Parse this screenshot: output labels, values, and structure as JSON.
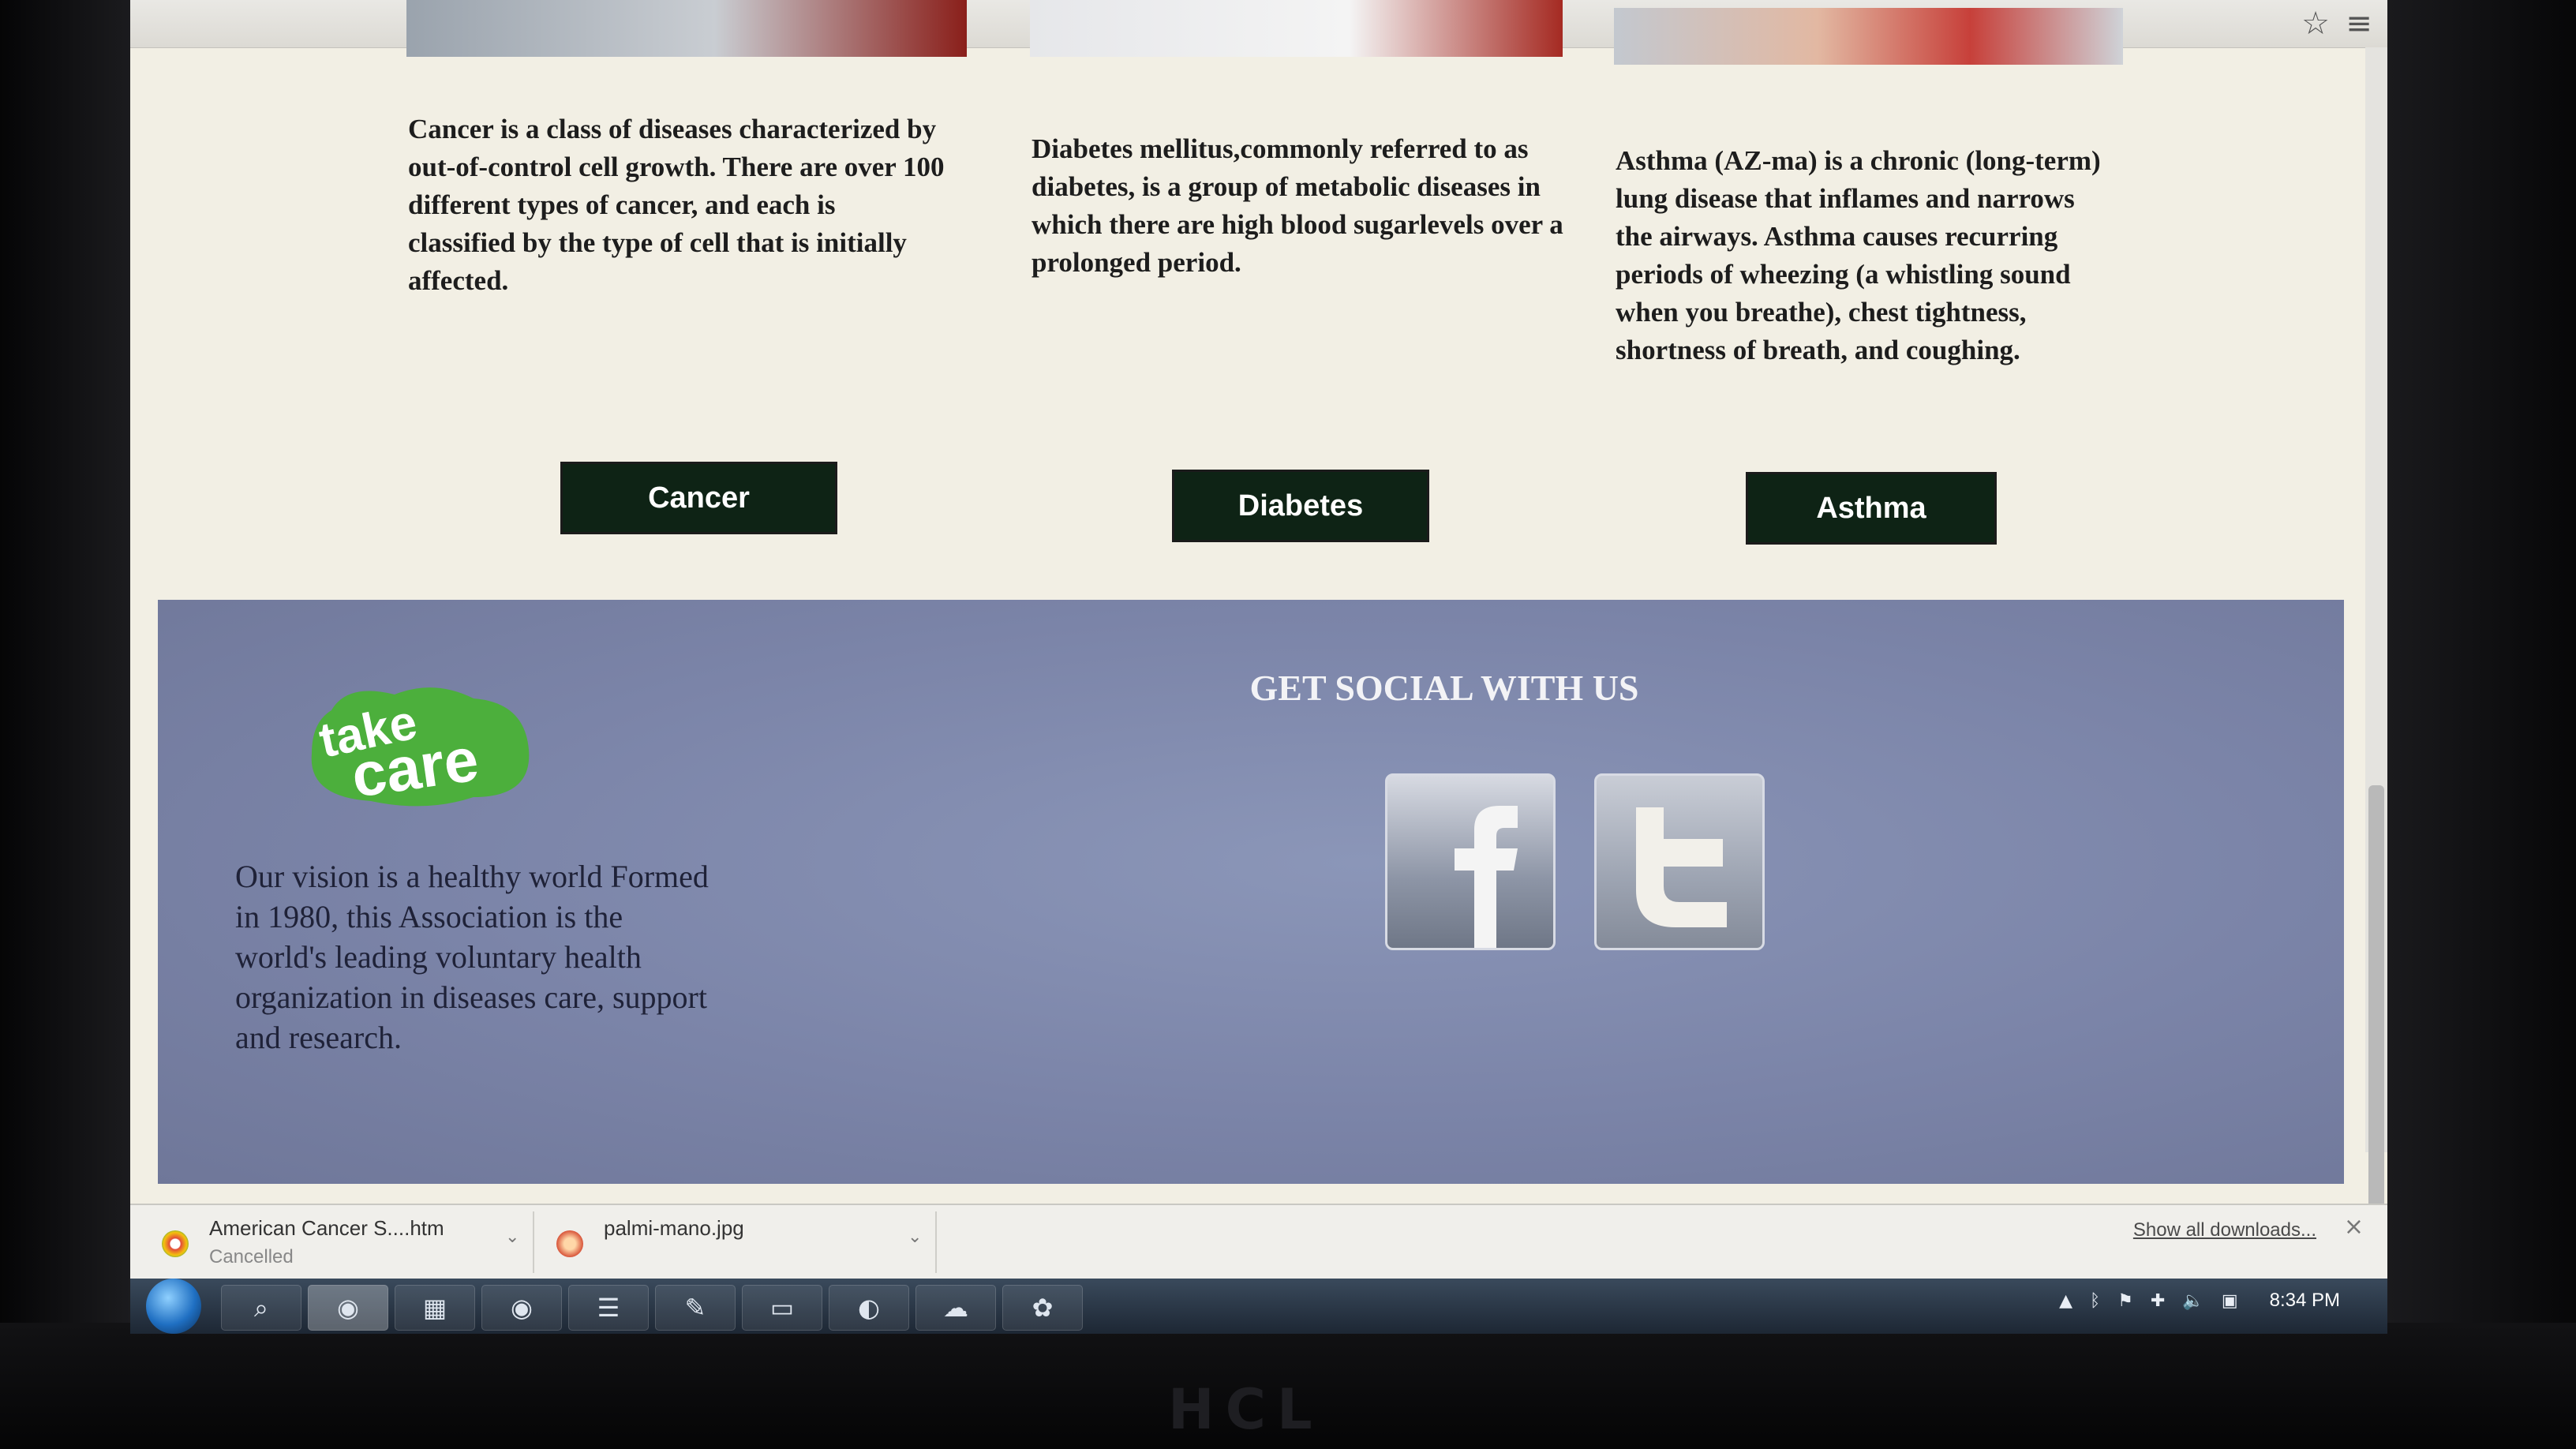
{
  "columns": [
    {
      "text": "Cancer is a class of diseases characterized by out-of-control cell growth. There are over 100 different types of cancer, and each is classified by the type of cell that is initially affected.",
      "button": "Cancer"
    },
    {
      "text": "Diabetes mellitus,commonly referred to as diabetes, is a group of metabolic diseases in which there are high blood sugarlevels over a prolonged period.",
      "button": "Diabetes"
    },
    {
      "text": "Asthma (AZ-ma) is a chronic (long-term) lung disease that inflames and narrows the airways. Asthma causes recurring periods of wheezing (a whistling sound when you breathe), chest tightness, shortness of breath, and coughing.",
      "button": "Asthma"
    }
  ],
  "footer": {
    "logo_top": "take",
    "logo_bottom": "care",
    "vision": "Our vision is a healthy world Formed in 1980, this Association is the world's leading voluntary health organization in diseases care, support and research.",
    "social_title": "GET SOCIAL WITH US",
    "social": [
      {
        "icon": "facebook-icon",
        "glyph": "f"
      },
      {
        "icon": "twitter-icon",
        "glyph": "t"
      }
    ]
  },
  "downloads": {
    "items": [
      {
        "name": "American Cancer S....htm",
        "status": "Cancelled"
      },
      {
        "name": "palmi-mano.jpg",
        "status": ""
      }
    ],
    "show_all": "Show all downloads..."
  },
  "taskbar": {
    "clock": "8:34 PM"
  },
  "colors": {
    "button_bg": "#0e2315",
    "footer_bg": "#7b84a8",
    "logo_green": "#4caf3c"
  }
}
